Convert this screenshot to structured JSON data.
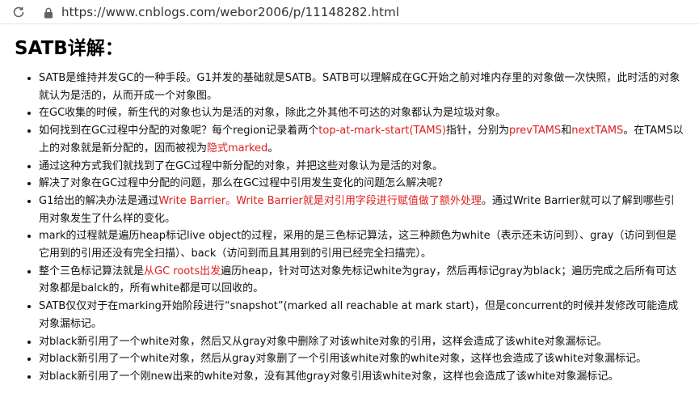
{
  "browser": {
    "url": "https://www.cnblogs.com/webor2006/p/11148282.html"
  },
  "article": {
    "heading": "SATB详解：",
    "items": [
      {
        "segments": [
          {
            "text": "SATB是维持并发GC的一种手段。G1并发的基础就是SATB。SATB可以理解成在GC开始之前对堆内存里的对象做一次快照，此时活的对象就认为是活的，从而开成一个对象图。",
            "red": false
          }
        ]
      },
      {
        "segments": [
          {
            "text": "在GC收集的时候，新生代的对象也认为是活的对象，除此之外其他不可达的对象都认为是垃圾对象。",
            "red": false
          }
        ]
      },
      {
        "segments": [
          {
            "text": "如何找到在GC过程中分配的对象呢？每个region记录着两个",
            "red": false
          },
          {
            "text": "top-at-mark-start(TAMS)",
            "red": true
          },
          {
            "text": "指针，分别为",
            "red": false
          },
          {
            "text": "prevTAMS",
            "red": true
          },
          {
            "text": "和",
            "red": false
          },
          {
            "text": "nextTAMS",
            "red": true
          },
          {
            "text": "。在TAMS以上的对象就是新分配的，因而被视为",
            "red": false
          },
          {
            "text": "隐式marked",
            "red": true
          },
          {
            "text": "。",
            "red": false
          }
        ]
      },
      {
        "segments": [
          {
            "text": "通过这种方式我们就找到了在GC过程中新分配的对象，并把这些对象认为是活的对象。",
            "red": false
          }
        ]
      },
      {
        "segments": [
          {
            "text": "解决了对象在GC过程中分配的问题，那么在GC过程中引用发生变化的问题怎么解决呢?",
            "red": false
          }
        ]
      },
      {
        "segments": [
          {
            "text": "G1给出的解决办法是通过",
            "red": false
          },
          {
            "text": "Write Barrier。Write Barrier就是对引用字段进行赋值做了额外处理",
            "red": true
          },
          {
            "text": "。通过Write Barrier就可以了解到哪些引用对象发生了什么样的变化。",
            "red": false
          }
        ]
      },
      {
        "segments": [
          {
            "text": "mark的过程就是遍历heap标记live object的过程，采用的是三色标记算法，这三种颜色为white（表示还未访问到）、gray（访问到但是它用到的引用还没有完全扫描）、back（访问到而且其用到的引用已经完全扫描完）。",
            "red": false
          }
        ]
      },
      {
        "segments": [
          {
            "text": "整个三色标记算法就是",
            "red": false
          },
          {
            "text": "从GC roots出发",
            "red": true
          },
          {
            "text": "遍历heap，针对可达对象先标记white为gray，然后再标记gray为black；遍历完成之后所有可达对象都是balck的，所有white都是可以回收的。",
            "red": false
          }
        ]
      },
      {
        "segments": [
          {
            "text": "SATB仅仅对于在marking开始阶段进行“snapshot”(marked all reachable at mark start)，但是concurrent的时候并发修改可能造成对象漏标记。",
            "red": false
          }
        ]
      },
      {
        "segments": [
          {
            "text": "对black新引用了一个white对象，然后又从gray对象中删除了对该white对象的引用，这样会造成了该white对象漏标记。",
            "red": false
          }
        ]
      },
      {
        "segments": [
          {
            "text": "对black新引用了一个white对象，然后从gray对象删了一个引用该white对象的white对象，这样也会造成了该white对象漏标记。",
            "red": false
          }
        ]
      },
      {
        "segments": [
          {
            "text": "对black新引用了一个刚new出来的white对象，没有其他gray对象引用该white对象，这样也会造成了该white对象漏标记。",
            "red": false
          }
        ]
      }
    ]
  },
  "colors": {
    "highlight": "#e02020",
    "text": "#111111"
  },
  "icons": {
    "reload": "reload-icon",
    "lock": "lock-icon"
  }
}
